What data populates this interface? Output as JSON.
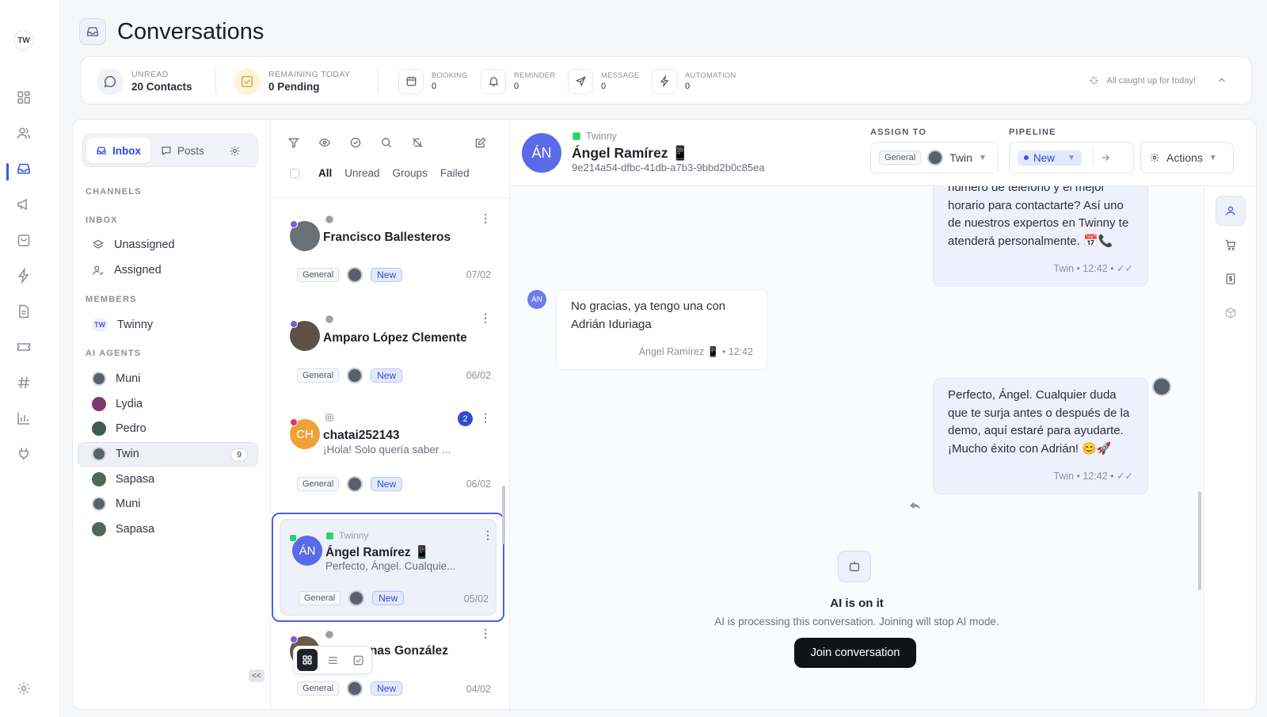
{
  "workspace_initials": "TW",
  "page_title": "Conversations",
  "stats": {
    "unread_label": "UNREAD",
    "unread_value": "20 Contacts",
    "remaining_label": "REMAINING TODAY",
    "remaining_value": "0 Pending",
    "booking_label": "BOOKING",
    "booking_value": "0",
    "reminder_label": "REMINDER",
    "reminder_value": "0",
    "message_label": "MESSAGE",
    "message_value": "0",
    "automation_label": "AUTOMATION",
    "automation_value": "0",
    "caught_up": "All caught up for today!"
  },
  "sidebar": {
    "inbox_tab": "Inbox",
    "posts_tab": "Posts",
    "channels_heading": "CHANNELS",
    "inbox_heading": "INBOX",
    "unassigned": "Unassigned",
    "assigned": "Assigned",
    "members_heading": "MEMBERS",
    "member_initials": "TW",
    "member_name": "Twinny",
    "agents_heading": "AI AGENTS",
    "agents": [
      {
        "name": "Muni"
      },
      {
        "name": "Lydia"
      },
      {
        "name": "Pedro"
      },
      {
        "name": "Twin",
        "count": "9"
      },
      {
        "name": "Sapasa"
      },
      {
        "name": "Muni"
      },
      {
        "name": "Sapasa"
      }
    ],
    "collapse": "<<"
  },
  "list": {
    "filters": {
      "all": "All",
      "unread": "Unread",
      "groups": "Groups",
      "failed": "Failed"
    },
    "conversations": [
      {
        "name": "Francisco Ballesteros",
        "tag": "General",
        "status": "New",
        "date": "07/02"
      },
      {
        "name": "Amparo López Clemente",
        "tag": "General",
        "status": "New",
        "date": "06/02"
      },
      {
        "initials": "CH",
        "name": "chatai252143",
        "preview": "¡Hola! Solo quería saber ...",
        "badge": "2",
        "tag": "General",
        "status": "New",
        "date": "06/02"
      },
      {
        "initials": "ÁN",
        "source": "Twinny",
        "name": "Ángel Ramírez 📱",
        "preview": "Perfecto, Ángel. Cualquie...",
        "tag": "General",
        "status": "New",
        "date": "05/02"
      },
      {
        "name": "...rnas González",
        "tag": "General",
        "status": "New",
        "date": "04/02"
      }
    ]
  },
  "chat": {
    "initials": "ÁN",
    "source": "Twinny",
    "name": "Ángel Ramírez 📱",
    "id": "9e214a54-dfbc-41db-a7b3-9bbd2b0c85ea",
    "assign_label": "ASSIGN TO",
    "assign_tag": "General",
    "assign_agent": "Twin",
    "pipeline_label": "PIPELINE",
    "pipeline_value": "New",
    "actions": "Actions",
    "messages": [
      {
        "text": "número de teléfono y el mejor horario para contactarte? Así uno de nuestros expertos en Twinny te atenderá personalmente. 📅📞",
        "meta": "Twin • 12:42 •"
      },
      {
        "avatar": "ÁN",
        "text": "No gracias, ya tengo una con Adrián Iduriaga",
        "meta": "Ángel Ramírez 📱 • 12:42"
      },
      {
        "text": "Perfecto, Ángel. Cualquier duda que te surja antes o después de la demo, aquí estaré para ayudarte. ¡Mucho éxito con Adrián! 😊🚀",
        "meta": "Twin • 12:42 •"
      }
    ],
    "ai_title": "AI is on it",
    "ai_subtitle": "AI is processing this conversation. Joining will stop AI mode.",
    "join": "Join conversation"
  },
  "colors": {
    "accent": "#3b5bdb",
    "new_badge_bg": "#e3e9fc",
    "avatar_purple": "#5b6ae8",
    "avatar_orange": "#f0a13a"
  }
}
